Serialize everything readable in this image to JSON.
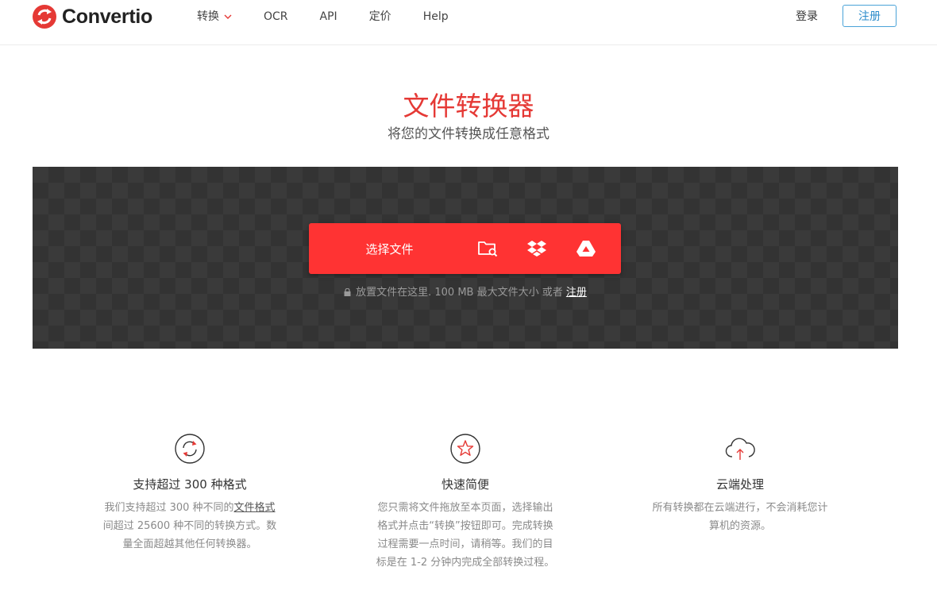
{
  "brand": {
    "name": "Convertio",
    "accent": "#e53935"
  },
  "nav": {
    "items": [
      {
        "label": "转换",
        "has_dropdown": true
      },
      {
        "label": "OCR"
      },
      {
        "label": "API"
      },
      {
        "label": "定价"
      },
      {
        "label": "Help"
      }
    ],
    "login": "登录",
    "register": "注册"
  },
  "hero": {
    "title": "文件转换器",
    "subtitle": "将您的文件转换成任意格式"
  },
  "upload": {
    "choose_file": "选择文件",
    "sources": [
      "folder-search-icon",
      "dropbox-icon",
      "google-drive-icon"
    ],
    "note_text": "放置文件在这里. 100 MB 最大文件大小 或者",
    "note_link": "注册"
  },
  "features": [
    {
      "icon": "refresh-icon",
      "title": "支持超过 300 种格式",
      "desc_lines": [
        [
          "我们支持超过 300 种不同的",
          "文件格式"
        ],
        [
          "间超过 25600 种不同的转换方式。数"
        ],
        [
          "量全面超越其他任何转换器。"
        ]
      ]
    },
    {
      "icon": "star-icon",
      "title": "快速简便",
      "desc_lines": [
        [
          "您只需将文件拖放至本页面，选择输出"
        ],
        [
          "格式并点击“转换”按钮即可。完成转换"
        ],
        [
          "过程需要一点时间，请稍等。我们的目"
        ],
        [
          "标是在 1-2 分钟内完成全部转换过程。"
        ]
      ]
    },
    {
      "icon": "cloud-upload-icon",
      "title": "云端处理",
      "desc_lines": [
        [
          "所有转换都在云端进行，不会消耗您计"
        ],
        [
          "算机的资源。"
        ]
      ]
    }
  ]
}
